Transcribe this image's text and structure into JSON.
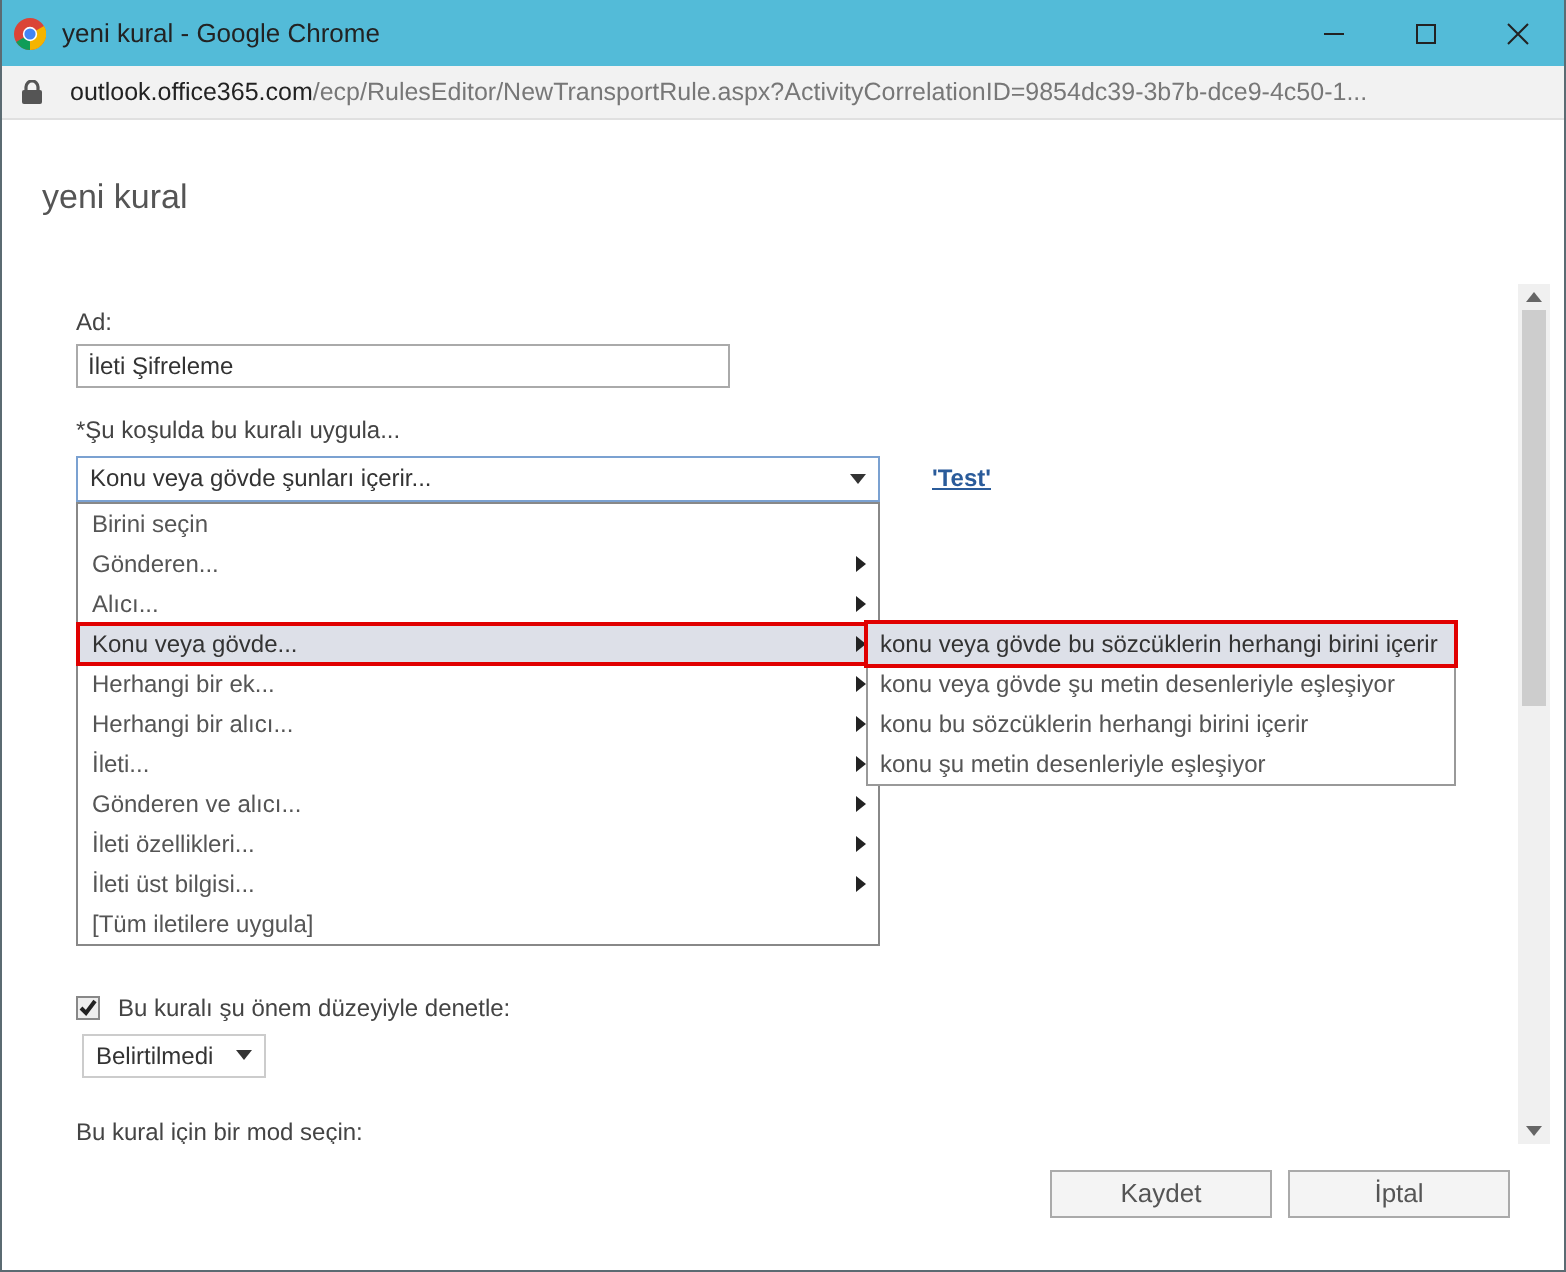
{
  "window": {
    "title": "yeni kural - Google Chrome",
    "url_host": "outlook.office365.com",
    "url_path": "/ecp/RulesEditor/NewTransportRule.aspx?ActivityCorrelationID=9854dc39-3b7b-dce9-4c50-1..."
  },
  "dialog_title": "yeni kural",
  "name_field": {
    "label": "Ad:",
    "value": "İleti Şifreleme"
  },
  "condition": {
    "label": "*Şu koşulda bu kuralı uygula...",
    "value": "Konu veya gövde şunları içerir...",
    "test_link": "'Test'"
  },
  "condition_menu": [
    {
      "label": "Birini seçin",
      "submenu": false,
      "selected": false
    },
    {
      "label": "Gönderen...",
      "submenu": true,
      "selected": false
    },
    {
      "label": "Alıcı...",
      "submenu": true,
      "selected": false
    },
    {
      "label": "Konu veya gövde...",
      "submenu": true,
      "selected": true
    },
    {
      "label": "Herhangi bir ek...",
      "submenu": true,
      "selected": false
    },
    {
      "label": "Herhangi bir alıcı...",
      "submenu": true,
      "selected": false
    },
    {
      "label": "İleti...",
      "submenu": true,
      "selected": false
    },
    {
      "label": "Gönderen ve alıcı...",
      "submenu": true,
      "selected": false
    },
    {
      "label": "İleti özellikleri...",
      "submenu": true,
      "selected": false
    },
    {
      "label": "İleti üst bilgisi...",
      "submenu": true,
      "selected": false
    },
    {
      "label": "[Tüm iletilere uygula]",
      "submenu": false,
      "selected": false
    }
  ],
  "submenu": [
    {
      "label": "konu veya gövde bu sözcüklerin herhangi birini içerir",
      "selected": true
    },
    {
      "label": "konu veya gövde şu metin desenleriyle eşleşiyor",
      "selected": false
    },
    {
      "label": "konu bu sözcüklerin herhangi birini içerir",
      "selected": false
    },
    {
      "label": "konu şu metin desenleriyle eşleşiyor",
      "selected": false
    }
  ],
  "audit": {
    "label": "Bu kuralı şu önem düzeyiyle denetle:",
    "checked": true,
    "severity": "Belirtilmedi"
  },
  "mode_label": "Bu kural için bir mod seçin:",
  "buttons": [
    "Kaydet",
    "İptal"
  ]
}
